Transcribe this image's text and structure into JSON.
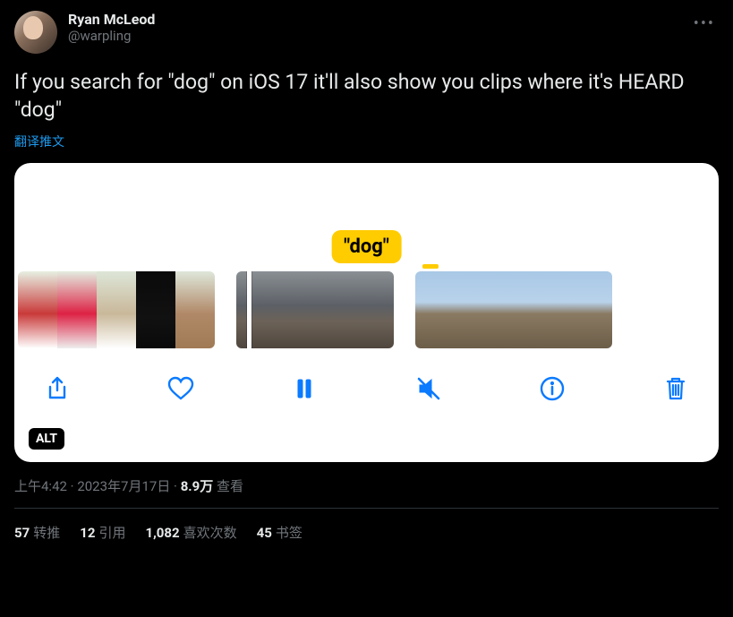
{
  "author": {
    "display_name": "Ryan McLeod",
    "handle": "@warpling"
  },
  "tweet_text": "If you search for \"dog\" on iOS 17 it'll also show you clips where it's HEARD \"dog\"",
  "translate_label": "翻译推文",
  "media": {
    "tag_label": "\"dog\"",
    "alt_badge": "ALT",
    "toolbar": {
      "share": "share",
      "like": "like",
      "pause": "pause",
      "mute": "mute",
      "info": "info",
      "delete": "delete"
    }
  },
  "meta": {
    "time": "上午4:42",
    "separator": " · ",
    "date": "2023年7月17日",
    "views_count": "8.9万",
    "views_label": " 查看"
  },
  "stats": {
    "retweets": {
      "count": "57",
      "label": "转推"
    },
    "quotes": {
      "count": "12",
      "label": "引用"
    },
    "likes": {
      "count": "1,082",
      "label": "喜欢次数"
    },
    "bookmarks": {
      "count": "45",
      "label": "书签"
    }
  }
}
